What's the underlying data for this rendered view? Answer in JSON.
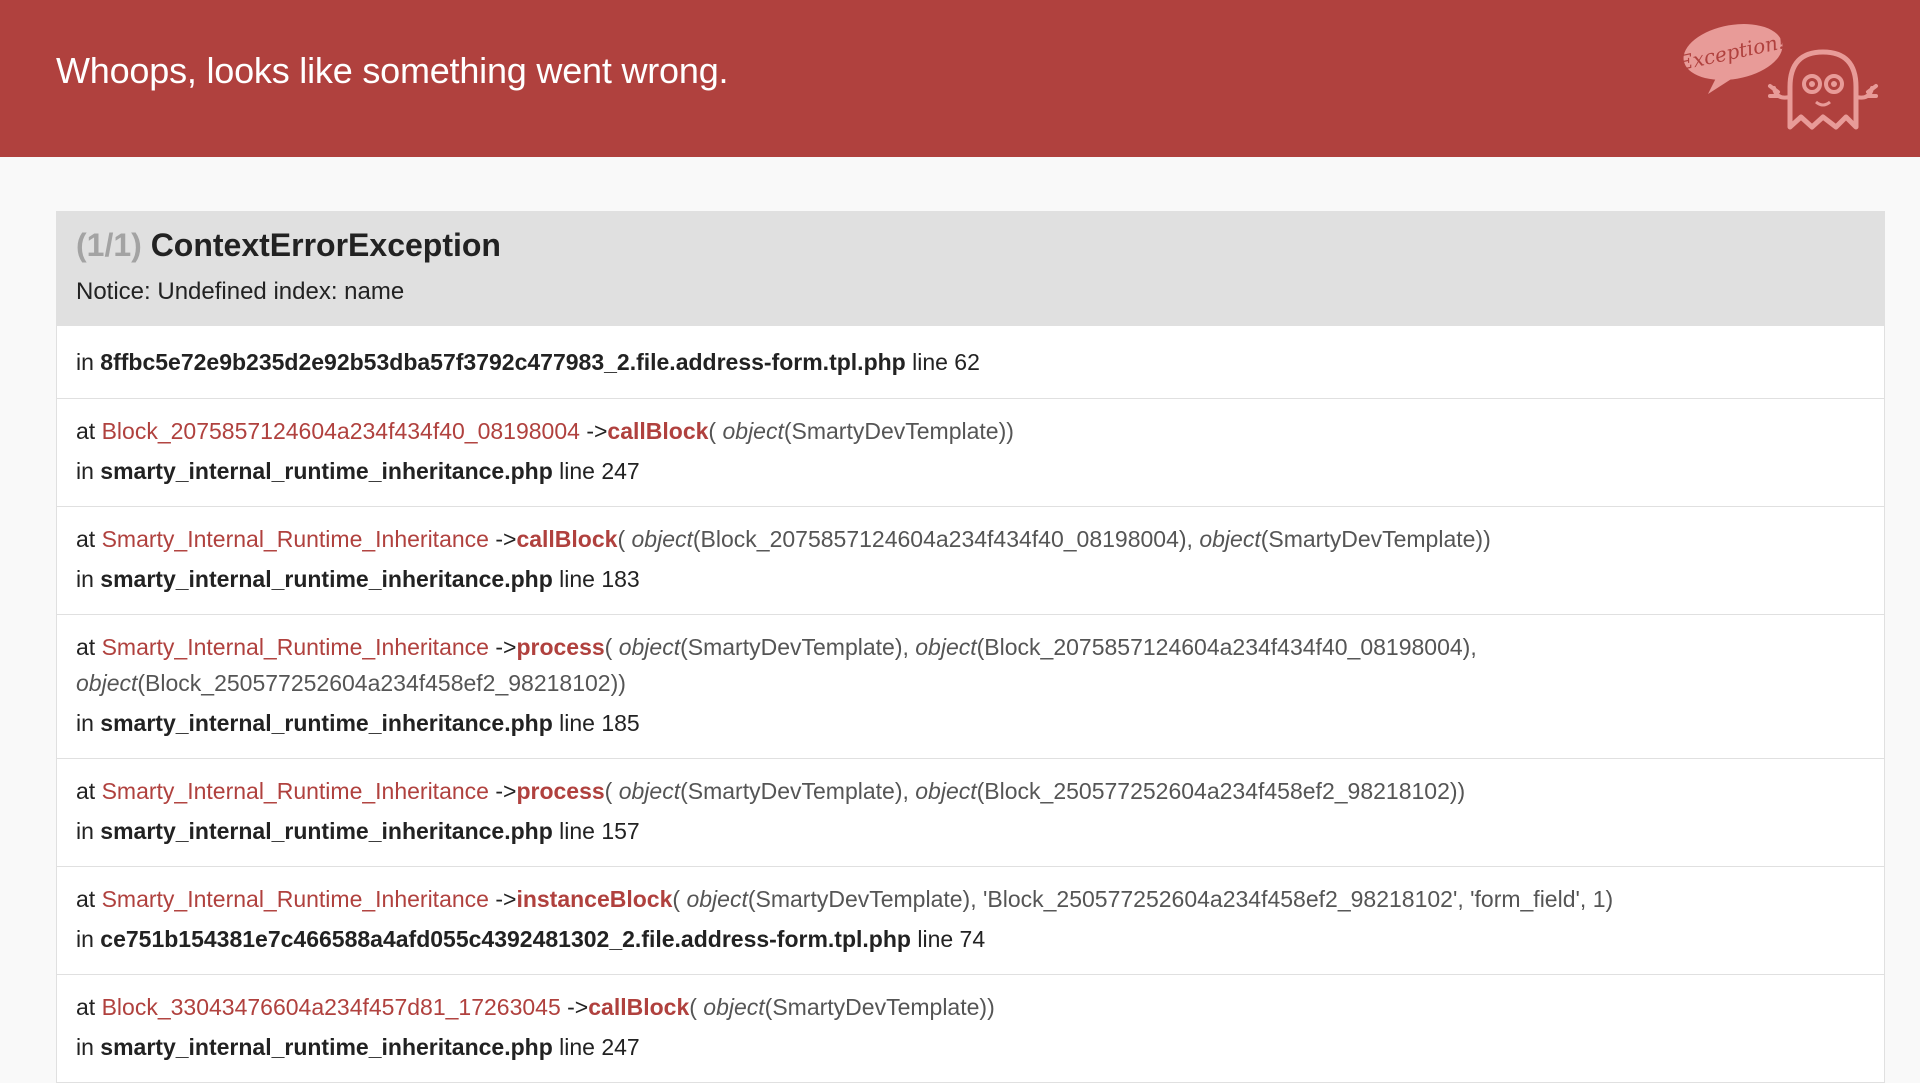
{
  "header": {
    "title": "Whoops, looks like something went wrong.",
    "badge_text": "Exception!"
  },
  "exception": {
    "counter": "(1/1)",
    "class": "ContextErrorException",
    "message": "Notice: Undefined index: name"
  },
  "first_location": {
    "in": "in",
    "file": "8ffbc5e72e9b235d2e92b53dba57f3792c477983_2.file.address-form.tpl.php",
    "line": "line 62"
  },
  "traces": [
    {
      "class": "Block_2075857124604a234f434f40_08198004",
      "method": "callBlock",
      "args": [
        {
          "type": "object",
          "value": "SmartyDevTemplate"
        }
      ],
      "file": "smarty_internal_runtime_inheritance.php",
      "line": "line 247"
    },
    {
      "class": "Smarty_Internal_Runtime_Inheritance",
      "method": "callBlock",
      "args": [
        {
          "type": "object",
          "value": "Block_2075857124604a234f434f40_08198004"
        },
        {
          "type": "object",
          "value": "SmartyDevTemplate"
        }
      ],
      "file": "smarty_internal_runtime_inheritance.php",
      "line": "line 183"
    },
    {
      "class": "Smarty_Internal_Runtime_Inheritance",
      "method": "process",
      "args": [
        {
          "type": "object",
          "value": "SmartyDevTemplate"
        },
        {
          "type": "object",
          "value": "Block_2075857124604a234f434f40_08198004"
        },
        {
          "type": "object",
          "value": "Block_250577252604a234f458ef2_98218102"
        }
      ],
      "file": "smarty_internal_runtime_inheritance.php",
      "line": "line 185"
    },
    {
      "class": "Smarty_Internal_Runtime_Inheritance",
      "method": "process",
      "args": [
        {
          "type": "object",
          "value": "SmartyDevTemplate"
        },
        {
          "type": "object",
          "value": "Block_250577252604a234f458ef2_98218102"
        }
      ],
      "file": "smarty_internal_runtime_inheritance.php",
      "line": "line 157"
    },
    {
      "class": "Smarty_Internal_Runtime_Inheritance",
      "method": "instanceBlock",
      "args": [
        {
          "type": "object",
          "value": "SmartyDevTemplate"
        },
        {
          "type": "",
          "value": "'Block_250577252604a234f458ef2_98218102'"
        },
        {
          "type": "",
          "value": "'form_field'"
        },
        {
          "type": "",
          "value": "1"
        }
      ],
      "file": "ce751b154381e7c466588a4afd055c4392481302_2.file.address-form.tpl.php",
      "line": "line 74"
    },
    {
      "class": "Block_33043476604a234f457d81_17263045",
      "method": "callBlock",
      "args": [
        {
          "type": "object",
          "value": "SmartyDevTemplate"
        }
      ],
      "file": "smarty_internal_runtime_inheritance.php",
      "line": "line 247"
    }
  ],
  "labels": {
    "at": "at",
    "in": "in",
    "arrow": "->"
  },
  "colors": {
    "header_bg": "#b0413e",
    "accent": "#b0413e",
    "block_head_bg": "#e0e0e0"
  },
  "icons": {
    "logo": "ghost-exception-logo-icon"
  }
}
